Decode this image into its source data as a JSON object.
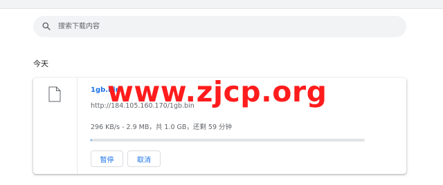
{
  "search": {
    "placeholder": "搜索下载内容",
    "value": "",
    "icon": "search-icon"
  },
  "section": {
    "date": "今天"
  },
  "download": {
    "file_icon": "file-icon",
    "file_name": "1gb.bin",
    "url": "http://184.105.160.170/1gb.bin",
    "status": "296 KB/s - 2.9 MB，共 1.0 GB，还剩 59 分钟",
    "progress_fraction": 0.003,
    "buttons": {
      "pause": "暂停",
      "cancel": "取消"
    }
  },
  "watermark": "www.zjcp.org",
  "colors": {
    "accent": "#1a73e8",
    "watermark": "#ff1c1c",
    "search_bg": "#f1f3f4"
  }
}
